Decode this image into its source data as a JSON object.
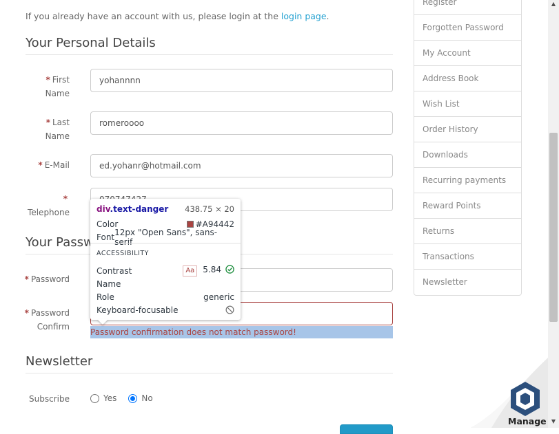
{
  "intro": {
    "text": "If you already have an account with us, please login at the ",
    "link": "login page",
    "suffix": "."
  },
  "sections": {
    "personal": "Your Personal Details",
    "password": "Your Passw",
    "newsletter": "Newsletter"
  },
  "fields": {
    "firstname": {
      "label_1": "First",
      "label_2": "Name",
      "value": "yohannnn"
    },
    "lastname": {
      "label_1": "Last",
      "label_2": "Name",
      "value": "romeroooo"
    },
    "email": {
      "label": "E-Mail",
      "value": "ed.yohanr@hotmail.com"
    },
    "telephone": {
      "label": "Telephone",
      "value": "070747427"
    },
    "password": {
      "label": "Password",
      "value": ""
    },
    "confirm": {
      "label_1": "Password",
      "label_2": "Confirm",
      "value": ""
    }
  },
  "required_mark": "*",
  "error_message": "Password confirmation does not match password!",
  "newsletter": {
    "label": "Subscribe",
    "yes": "Yes",
    "no": "No",
    "selected": "No"
  },
  "sidebar": {
    "items": [
      "Register",
      "Forgotten Password",
      "My Account",
      "Address Book",
      "Wish List",
      "Order History",
      "Downloads",
      "Recurring payments",
      "Reward Points",
      "Returns",
      "Transactions",
      "Newsletter"
    ]
  },
  "inspector": {
    "tag": "div",
    "class": ".text-danger",
    "dimensions": "438.75 × 20",
    "color_label": "Color",
    "color_value": "#A94442",
    "font_label": "Font",
    "font_value": "12px \"Open Sans\", sans-serif",
    "section": "ACCESSIBILITY",
    "contrast_label": "Contrast",
    "contrast_aa": "Aa",
    "contrast_value": "5.84",
    "name_label": "Name",
    "role_label": "Role",
    "role_value": "generic",
    "focus_label": "Keyboard-focusable"
  },
  "manage": {
    "label": "Manage"
  },
  "colors": {
    "danger": "#a94442",
    "link": "#23a1d1",
    "highlight": "#a7c5e8"
  }
}
